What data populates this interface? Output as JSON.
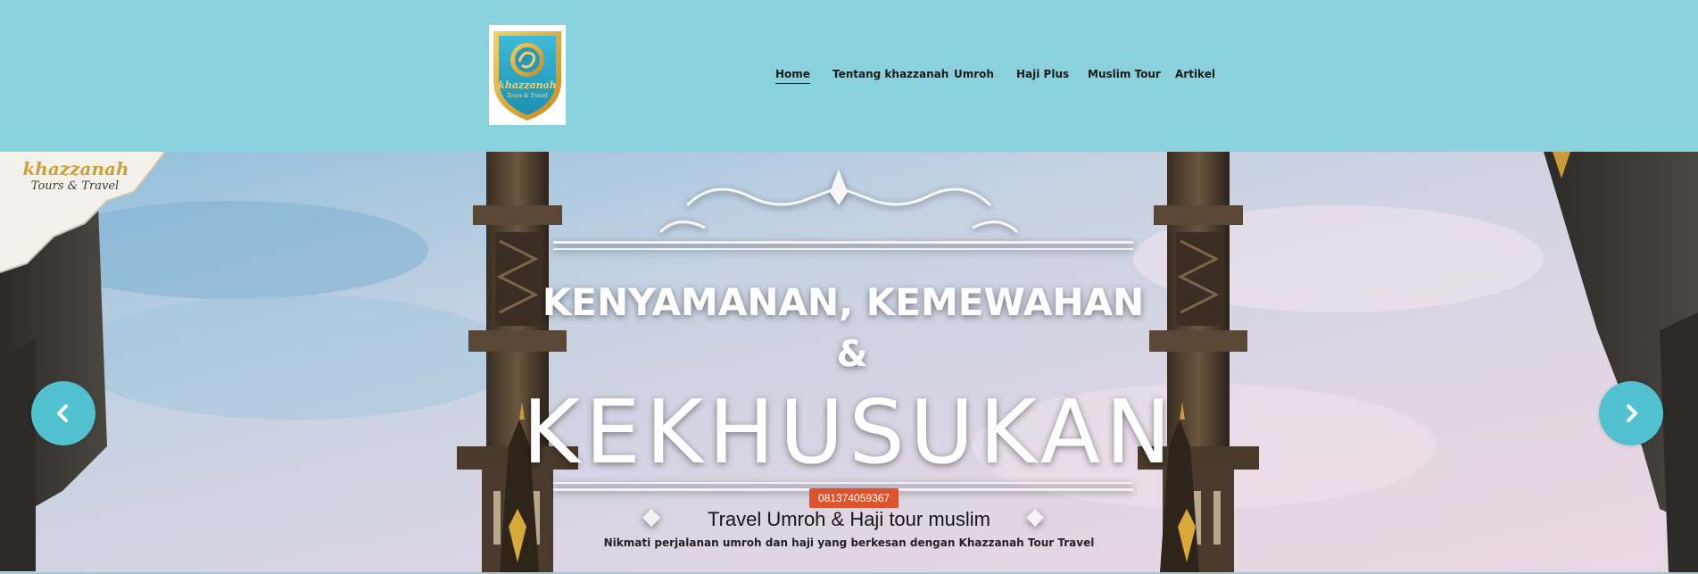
{
  "header": {
    "logo": {
      "name_text": "khazzanah",
      "sub_text": "Tours & Travel"
    },
    "nav": [
      {
        "label": "Home",
        "active": true
      },
      {
        "label": "Tentang khazzanah",
        "active": false
      },
      {
        "label": "Umroh",
        "active": false
      },
      {
        "label": "Haji Plus",
        "active": false
      },
      {
        "label": "Muslim Tour",
        "active": false
      },
      {
        "label": "Artikel",
        "active": false
      }
    ]
  },
  "hero": {
    "corner_brand_name": "khazzanah",
    "corner_brand_sub": "Tours & Travel",
    "headline_line1": "KENYAMANAN, KEMEWAHAN",
    "headline_amp": "&",
    "headline_line3": "KEKHUSUKAN",
    "phone_badge": "081374059367",
    "caption_title": "Travel Umroh & Haji tour muslim",
    "caption_subtitle": "Nikmati perjalanan umroh dan haji yang berkesan dengan Khazzanah Tour Travel",
    "prev_icon": "chevron-left-icon",
    "next_icon": "chevron-right-icon"
  },
  "colors": {
    "header_bg": "#8ad1de",
    "arrow_bg": "#52c1cf",
    "badge_bg": "#d9542f",
    "logo_gold": "#d9a93a",
    "logo_teal": "#2aa7c4"
  }
}
